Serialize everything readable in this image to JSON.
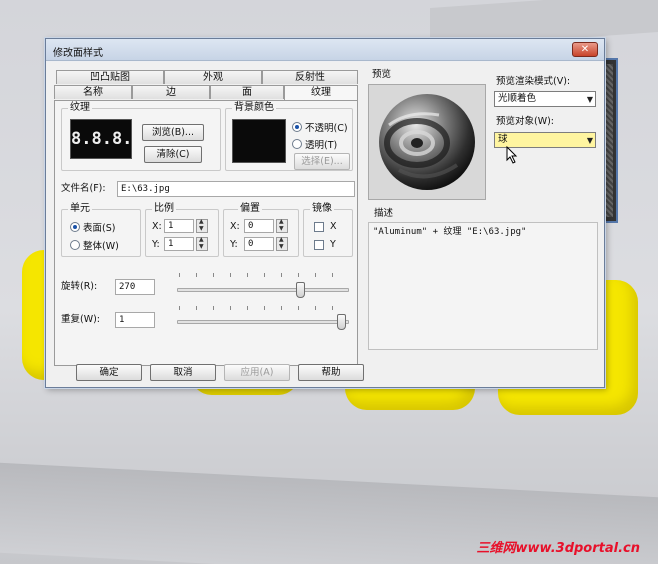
{
  "window": {
    "title": "修改面样式",
    "close_label": "✕"
  },
  "tabs": {
    "row1": [
      "凹凸贴图",
      "外观",
      "反射性"
    ],
    "row2": [
      "名称",
      "边",
      "面",
      "纹理"
    ]
  },
  "texture_group": {
    "label": "纹理",
    "preview_text": "8.8.8.",
    "browse_button": "浏览(B)...",
    "clear_button": "清除(C)"
  },
  "bg_color_group": {
    "label": "背景颜色",
    "opaque_radio": "不透明(C)",
    "transparent_radio": "透明(T)",
    "select_button": "选择(E)..."
  },
  "filename": {
    "label": "文件名(F):",
    "value": "E:\\63.jpg"
  },
  "unit_group": {
    "label": "单元",
    "surface_radio": "表面(S)",
    "whole_radio": "整体(W)"
  },
  "scale_group": {
    "label": "比例",
    "x_label": "X:",
    "x_value": "1",
    "y_label": "Y:",
    "y_value": "1"
  },
  "offset_group": {
    "label": "偏置",
    "x_label": "X:",
    "x_value": "0",
    "y_label": "Y:",
    "y_value": "0"
  },
  "mirror_group": {
    "label": "镜像",
    "x_label": "X",
    "y_label": "Y"
  },
  "rotation": {
    "label": "旋转(R):",
    "value": "270",
    "slider_fraction": 0.73
  },
  "repeat": {
    "label": "重复(W):",
    "value": "1",
    "slider_fraction": 0.98
  },
  "preview": {
    "label": "预览",
    "render_mode_label": "预览渲染模式(V):",
    "render_mode_value": "光顺着色",
    "object_label": "预览对象(W):",
    "object_value": "球"
  },
  "description": {
    "label": "描述",
    "text": "\"Aluminum\" + 纹理 \"E:\\63.jpg\""
  },
  "buttons": {
    "ok": "确定",
    "cancel": "取消",
    "apply": "应用(A)",
    "help": "帮助"
  },
  "watermark": "三维网www.3dportal.cn",
  "colors": {
    "accent_yellow": "#f5e600",
    "watermark_red": "#e8102a",
    "titlebar_blue": "#c7d4e6"
  }
}
